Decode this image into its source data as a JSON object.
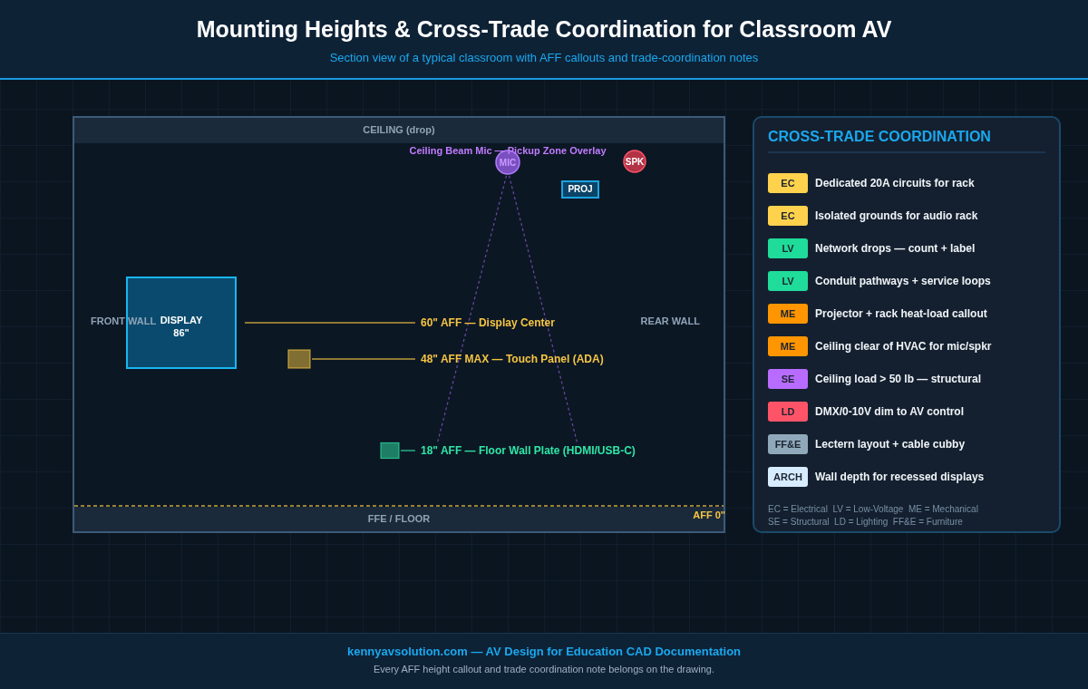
{
  "header": {
    "title": "Mounting Heights & Cross-Trade Coordination for Classroom AV",
    "subtitle": "Section view of a typical classroom with AFF callouts and trade-coordination notes"
  },
  "diagram": {
    "ceiling": "CEILING (drop)",
    "floor": "FFE / FLOOR",
    "aff_zero": "AFF 0\"",
    "front_wall": "FRONT WALL",
    "rear_wall": "REAR WALL",
    "display": {
      "label": "DISPLAY",
      "size": "86\""
    },
    "mic": {
      "label": "MIC",
      "caption": "Ceiling Beam Mic — Pickup Zone Overlay"
    },
    "speaker": {
      "label": "SPK"
    },
    "projector": {
      "label": "PROJ"
    },
    "callouts": [
      {
        "kind": "display",
        "text": "60\" AFF — Display Center",
        "color": "#f5c542"
      },
      {
        "kind": "device",
        "text": "48\" AFF MAX — Touch Panel (ADA)",
        "color": "#f5c542"
      },
      {
        "kind": "device",
        "text": "18\" AFF — Floor Wall Plate (HDMI/USB-C)",
        "color": "#2ee6a6"
      }
    ]
  },
  "panel": {
    "title": "CROSS-TRADE COORDINATION",
    "items": [
      {
        "tag": "EC",
        "text": "Dedicated 20A circuits for rack",
        "color": "#ffd24d"
      },
      {
        "tag": "EC",
        "text": "Isolated grounds for audio rack",
        "color": "#ffd24d"
      },
      {
        "tag": "LV",
        "text": "Network drops — count + label",
        "color": "#1fdc9a"
      },
      {
        "tag": "LV",
        "text": "Conduit pathways + service loops",
        "color": "#1fdc9a"
      },
      {
        "tag": "ME",
        "text": "Projector + rack heat-load callout",
        "color": "#ff9500"
      },
      {
        "tag": "ME",
        "text": "Ceiling clear of HVAC for mic/spkr",
        "color": "#ff9500"
      },
      {
        "tag": "SE",
        "text": "Ceiling load > 50 lb — structural",
        "color": "#b86cff"
      },
      {
        "tag": "LD",
        "text": "DMX/0-10V dim to AV control",
        "color": "#ff5468"
      },
      {
        "tag": "FF&E",
        "text": "Lectern layout + cable cubby",
        "color": "#8fa9bb"
      },
      {
        "tag": "ARCH",
        "text": "Wall depth for recessed displays",
        "color": "#d7ecff"
      }
    ],
    "legend": [
      "EC = Electrical  LV = Low-Voltage  ME = Mechanical",
      "SE = Structural  LD = Lighting  FF&E = Furniture"
    ]
  },
  "footer": {
    "title": "kennyavsolution.com — AV Design for Education CAD Documentation",
    "note": "Every AFF height callout and trade coordination note belongs on the drawing."
  }
}
